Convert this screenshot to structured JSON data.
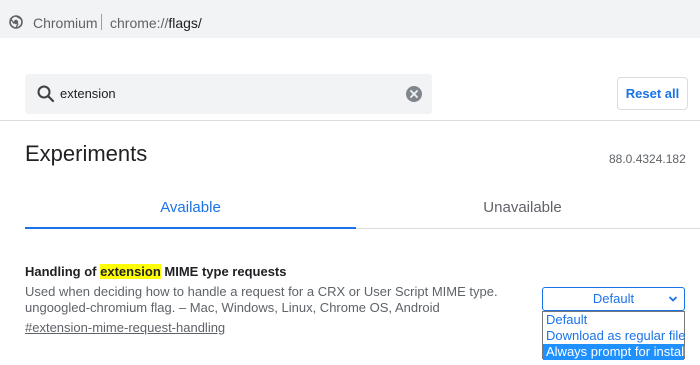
{
  "browser": {
    "site_name": "Chromium",
    "url_scheme": "chrome://",
    "url_path": "flags/"
  },
  "search": {
    "value": "extension",
    "reset_label": "Reset all"
  },
  "header": {
    "title": "Experiments",
    "version": "88.0.4324.182"
  },
  "tabs": [
    {
      "label": "Available",
      "active": true
    },
    {
      "label": "Unavailable",
      "active": false
    }
  ],
  "experiment": {
    "title_before": "Handling of ",
    "title_highlight": "extension",
    "title_after": " MIME type requests",
    "description": "Used when deciding how to handle a request for a CRX or User Script MIME type.",
    "platforms": "ungoogled-chromium flag. – Mac, Windows, Linux, Chrome OS, Android",
    "link": "#extension-mime-request-handling",
    "select": {
      "selected_value": "Default",
      "options": [
        "Default",
        "Download as regular file",
        "Always prompt for install"
      ],
      "highlighted_option": "Always prompt for install"
    }
  },
  "colors": {
    "accent": "#1a73e8",
    "highlight": "#ffff00",
    "dropdown_selected": "#1e90ff"
  }
}
